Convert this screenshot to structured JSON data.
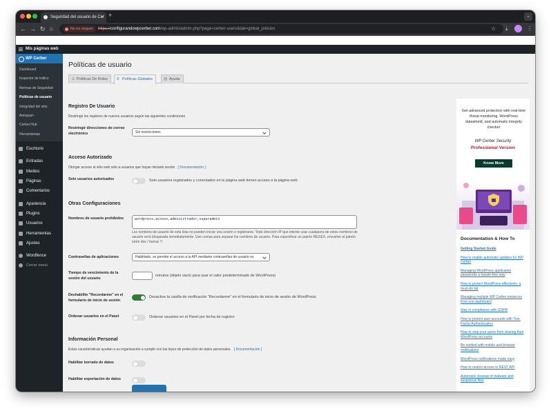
{
  "browser": {
    "tab_title": "Seguridad del usuario de Cer",
    "security_label": "No es seguro",
    "url_scheme": "https://",
    "url_domain": "configurandowpcerber.com",
    "url_path": "/wp-admin/admin.php?page=cerber-users&tab=global_policies"
  },
  "adminbar": {
    "site_name": "Mis páginas web"
  },
  "sidebar": {
    "plugin": "WP Cerber",
    "sub_items": [
      "Dashboard",
      "Inspector de tráfico",
      "Normas de Seguridad",
      "Políticas de usuario",
      "Integridad del sitio",
      "Antispam",
      "Cerber.Hub",
      "Herramientas"
    ],
    "current_sub": 3,
    "menu": [
      {
        "label": "Escritorio",
        "icon": "dashboard-icon"
      },
      {
        "label": "Entradas",
        "icon": "pin-icon"
      },
      {
        "label": "Medios",
        "icon": "media-icon"
      },
      {
        "label": "Páginas",
        "icon": "page-icon"
      },
      {
        "label": "Comentarios",
        "icon": "comment-icon"
      },
      {
        "label": "Apariencia",
        "icon": "brush-icon"
      },
      {
        "label": "Plugins",
        "icon": "plugin-icon"
      },
      {
        "label": "Usuarios",
        "icon": "users-icon"
      },
      {
        "label": "Herramientas",
        "icon": "wrench-icon"
      },
      {
        "label": "Ajustes",
        "icon": "settings-icon"
      },
      {
        "label": "Wordfence",
        "icon": "wordfence-icon"
      }
    ],
    "collapse": "Cerrar menú"
  },
  "page": {
    "title": "Políticas de usuario",
    "tabs": [
      {
        "label": "Políticas De Roles",
        "icon": "users-icon"
      },
      {
        "label": "Políticas Globales",
        "icon": "sliders-icon"
      },
      {
        "label": "Ayuda",
        "icon": "help-icon"
      }
    ],
    "active_tab": 1
  },
  "registro": {
    "title": "Registro De Usuario",
    "desc": "Restringir los registros de nuevos usuarios según las siguientes condiciones",
    "email_label": "Restringir direcciones de correo electrónico",
    "email_value": "Sin restricciones"
  },
  "acceso": {
    "title": "Acceso Autorizado",
    "desc": "Otorgar acceso al sitio web solo a usuarios que hayan iniciado sesión",
    "doc_link": "[ Documentación ]",
    "only_label": "Solo usuarios autorizados",
    "only_text": "Solo usuarios registrados y conectados en la página web tienen acceso a la página web",
    "only_on": false
  },
  "otras": {
    "title": "Otras Configuraciones",
    "prohibited_label": "Nombres de usuario prohibidos",
    "prohibited_value": "wordpress,acceso,administrador,superadmin",
    "prohibited_help": "Los nombres de usuario de esta lista no pueden iniciar una sesión o registrarse. Toda dirección IP que intente usar cualquiera de estos nombres de usuario será bloqueada inmediatamente. Use comas para separar los nombres de usuario. Para especificar un patrón REGEX, envuelve el patrón entre dos / barras */.",
    "app_pw_label": "Contraseñas de aplicaciones",
    "app_pw_value": "Habilitado, se permite el acceso a la API mediante contraseñas de usuario es",
    "expire_label": "Tiempo de vencimiento de la sesión del usuario",
    "expire_text": "minutos (déjelo vacío para usar el valor predeterminado de WordPress)",
    "remember_label": "Deshabilite \"Recordarme\" en el formulario de inicio de sesión",
    "remember_text": "Desactive la casilla de verificación \"Recordarme\" en el formulario de inicio de sesión de WordPress",
    "remember_on": true,
    "order_label": "Ordenar usuarios en el Panel",
    "order_text": "Ordenar usuarios en el Panel por fecha de registro",
    "order_on": false
  },
  "personal": {
    "title": "Información Personal",
    "desc": "Estas características ayudan a su organización a cumplir con las leyes de protección de datos personales.",
    "doc_link": "[ Documentación ]",
    "erase_label": "Habilitar borrado de datos",
    "export_label": "Habilitar exportación de datos"
  },
  "promo": {
    "text": "Get advanced protection with real-time threat monitoring, WordPress datashield, and automatic integrity checker",
    "brand": "WP Cerber Security",
    "edition": "Professional Version",
    "button": "Know More",
    "accent": "#c8102e",
    "button_color": "#0b3b2e"
  },
  "docs": {
    "title": "Documentation & How To",
    "links": [
      "Getting Started Guide",
      "How to enable automatic updates for WP Cerber",
      "Managing WordPress application passwords a hassle-free way",
      "How to protect WordPress effectively: a must-do list",
      "Managing multiple WP Cerber instances from one dashboard",
      "Stay in compliance with GDPR",
      "How to protect user accounts with Two-Factor Authentication",
      "How to stop your users from sharing their WordPress accounts",
      "Be notified with mobile and browser notifications",
      "WordPress notifications made easy",
      "How to restrict access to REST API",
      "Automatic cleanup of malware and suspicious files"
    ]
  }
}
